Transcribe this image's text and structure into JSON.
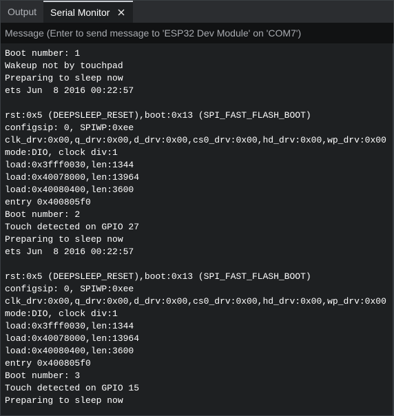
{
  "tabs": [
    {
      "label": "Output"
    },
    {
      "label": "Serial Monitor"
    }
  ],
  "message_input": {
    "placeholder": "Message (Enter to send message to 'ESP32 Dev Module' on 'COM7')"
  },
  "console_lines": [
    "Boot number: 1",
    "Wakeup not by touchpad",
    "Preparing to sleep now",
    "ets Jun  8 2016 00:22:57",
    "",
    "rst:0x5 (DEEPSLEEP_RESET),boot:0x13 (SPI_FAST_FLASH_BOOT)",
    "configsip: 0, SPIWP:0xee",
    "clk_drv:0x00,q_drv:0x00,d_drv:0x00,cs0_drv:0x00,hd_drv:0x00,wp_drv:0x00",
    "mode:DIO, clock div:1",
    "load:0x3fff0030,len:1344",
    "load:0x40078000,len:13964",
    "load:0x40080400,len:3600",
    "entry 0x400805f0",
    "Boot number: 2",
    "Touch detected on GPIO 27",
    "Preparing to sleep now",
    "ets Jun  8 2016 00:22:57",
    "",
    "rst:0x5 (DEEPSLEEP_RESET),boot:0x13 (SPI_FAST_FLASH_BOOT)",
    "configsip: 0, SPIWP:0xee",
    "clk_drv:0x00,q_drv:0x00,d_drv:0x00,cs0_drv:0x00,hd_drv:0x00,wp_drv:0x00",
    "mode:DIO, clock div:1",
    "load:0x3fff0030,len:1344",
    "load:0x40078000,len:13964",
    "load:0x40080400,len:3600",
    "entry 0x400805f0",
    "Boot number: 3",
    "Touch detected on GPIO 15",
    "Preparing to sleep now"
  ],
  "icons": {
    "close": "close-icon"
  },
  "colors": {
    "background": "#1e2022",
    "tabbar": "#2b2d30",
    "message_bar": "#111213",
    "text": "#ffffff",
    "muted": "#a8abb0"
  }
}
